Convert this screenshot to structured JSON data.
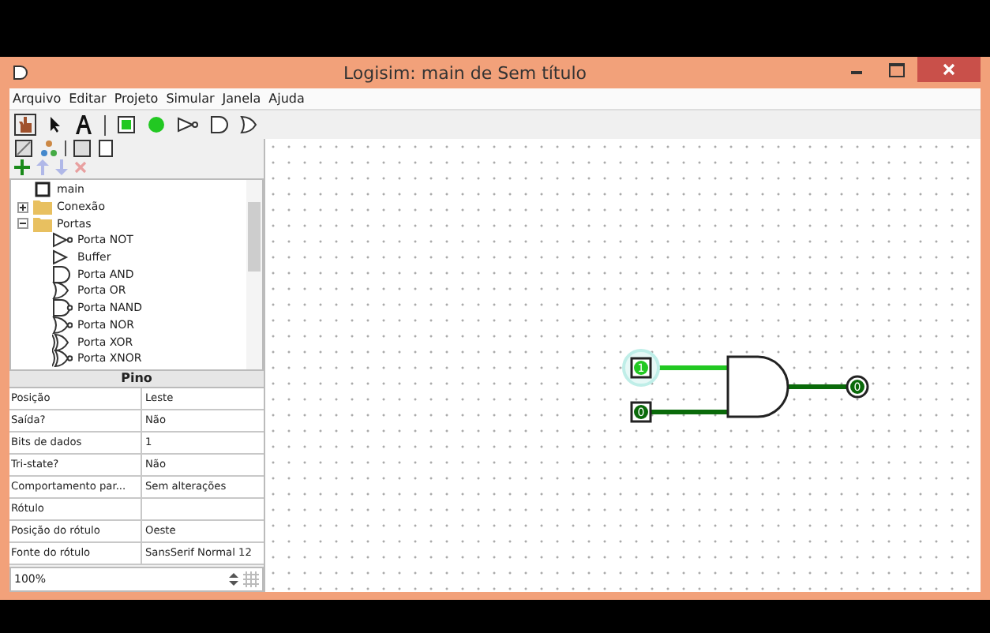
{
  "window": {
    "title": "Logisim: main de Sem título"
  },
  "menu": [
    "Arquivo",
    "Editar",
    "Projeto",
    "Simular",
    "Janela",
    "Ajuda"
  ],
  "tree": [
    {
      "label": "main",
      "kind": "circuit"
    },
    {
      "label": "Conexão",
      "kind": "folder",
      "expanded": false
    },
    {
      "label": "Portas",
      "kind": "folder",
      "expanded": true,
      "children": [
        {
          "label": "Porta NOT",
          "kind": "not"
        },
        {
          "label": "Buffer",
          "kind": "buffer"
        },
        {
          "label": "Porta AND",
          "kind": "and"
        },
        {
          "label": "Porta OR",
          "kind": "or"
        },
        {
          "label": "Porta NAND",
          "kind": "nand"
        },
        {
          "label": "Porta NOR",
          "kind": "nor"
        },
        {
          "label": "Porta XOR",
          "kind": "xor"
        },
        {
          "label": "Porta XNOR",
          "kind": "xnor"
        }
      ]
    }
  ],
  "properties": {
    "title": "Pino",
    "rows": [
      {
        "name": "Posição",
        "value": "Leste"
      },
      {
        "name": "Saída?",
        "value": "Não"
      },
      {
        "name": "Bits de dados",
        "value": "1"
      },
      {
        "name": "Tri-state?",
        "value": "Não"
      },
      {
        "name": "Comportamento par...",
        "value": "Sem alterações"
      },
      {
        "name": "Rótulo",
        "value": ""
      },
      {
        "name": "Posição do rótulo",
        "value": "Oeste"
      },
      {
        "name": "Fonte do rótulo",
        "value": "SansSerif Normal 12"
      }
    ]
  },
  "zoom": "100%",
  "circuit": {
    "inputs": [
      {
        "value": "1",
        "on": true,
        "selected": true
      },
      {
        "value": "0",
        "on": false,
        "selected": false
      }
    ],
    "output": {
      "value": "0",
      "on": false
    }
  }
}
